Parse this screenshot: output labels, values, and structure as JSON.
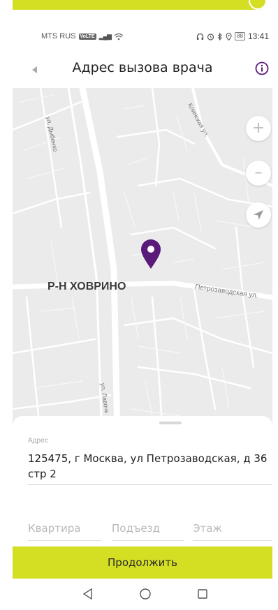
{
  "status_bar": {
    "carrier": "MTS RUS",
    "volte": "VoLTE",
    "signal": "▂▄▆",
    "wifi": "wifi-icon",
    "battery": "88",
    "time": "13:41"
  },
  "app_bar": {
    "title": "Адрес вызова врача",
    "back_icon": "back-arrow-icon",
    "info_icon": "info-icon"
  },
  "map": {
    "district": "Р-Н ХОВРИНО",
    "streets": [
      "ул. Дыбенко",
      "Клинская ул.",
      "Петрозаводская ул.",
      "ул. Лавочк"
    ],
    "zoom_in": "+",
    "zoom_out": "–",
    "marker_color": "#5a1a7a"
  },
  "address_sheet": {
    "label": "Адрес",
    "value": "125475, г Москва, ул Петрозаводская, д 36 стр 2",
    "apartment_placeholder": "Квартира",
    "entrance_placeholder": "Подъезд",
    "floor_placeholder": "Этаж"
  },
  "actions": {
    "continue_label": "Продолжить"
  },
  "colors": {
    "accent": "#d4de23",
    "marker": "#5a1a7a"
  }
}
